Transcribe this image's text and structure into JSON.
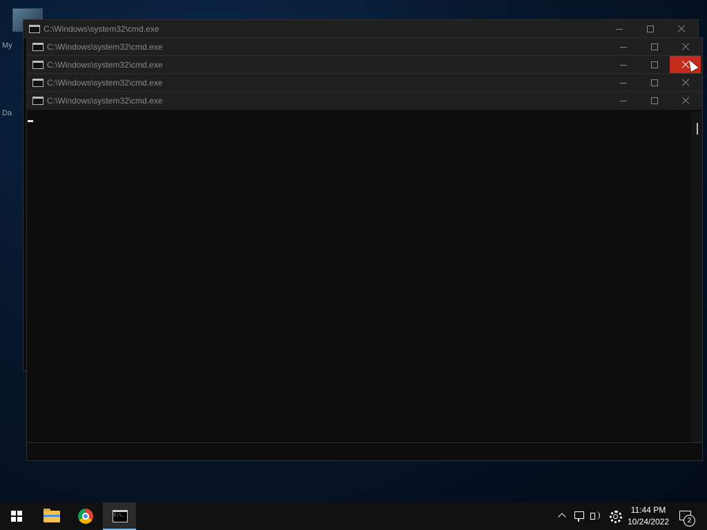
{
  "desktop": {
    "icon_labels": [
      "My",
      "Da"
    ]
  },
  "windows": [
    {
      "title": "C:\\Windows\\system32\\cmd.exe"
    },
    {
      "title": "C:\\Windows\\system32\\cmd.exe"
    },
    {
      "title": "C:\\Windows\\system32\\cmd.exe"
    },
    {
      "title": "C:\\Windows\\system32\\cmd.exe"
    },
    {
      "title": "C:\\Windows\\system32\\cmd.exe"
    }
  ],
  "taskbar": {
    "icons": [
      "windows-start-icon",
      "file-explorer-icon",
      "chrome-icon",
      "cmd-icon"
    ],
    "tray": {
      "time": "11:44 PM",
      "date": "10/24/2022",
      "notification_count": "2"
    }
  },
  "colors": {
    "close_hover": "#c42b1c",
    "title_text": "#8a8a8a",
    "taskbar_accent": "#76b9ed"
  }
}
